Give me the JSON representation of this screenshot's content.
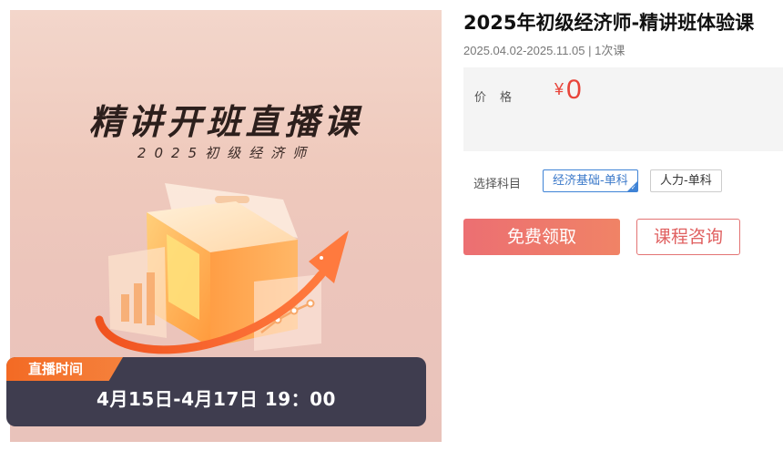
{
  "poster": {
    "headline": "精讲开班直播课",
    "subheadline": "2025初级经济师",
    "live_tag": "直播时间",
    "live_time": "4月15日-4月17日 19：00"
  },
  "course": {
    "title": "2025年初级经济师-精讲班体验课",
    "meta": "2025.04.02-2025.11.05 | 1次课"
  },
  "price": {
    "label": "价格",
    "currency": "¥",
    "value": "0"
  },
  "subject": {
    "label": "选择科目",
    "options": [
      {
        "label": "经济基础-单科",
        "selected": true
      },
      {
        "label": "人力-单科",
        "selected": false
      }
    ]
  },
  "actions": {
    "free_label": "免费领取",
    "consult_label": "课程咨询"
  },
  "colors": {
    "accent_red": "#e8443a",
    "button_gradient_start": "#ec6f72",
    "button_gradient_end": "#f08366",
    "selected_blue": "#3f83d6",
    "live_bar": "#3f3d4f",
    "live_tag": "#f36a24"
  }
}
